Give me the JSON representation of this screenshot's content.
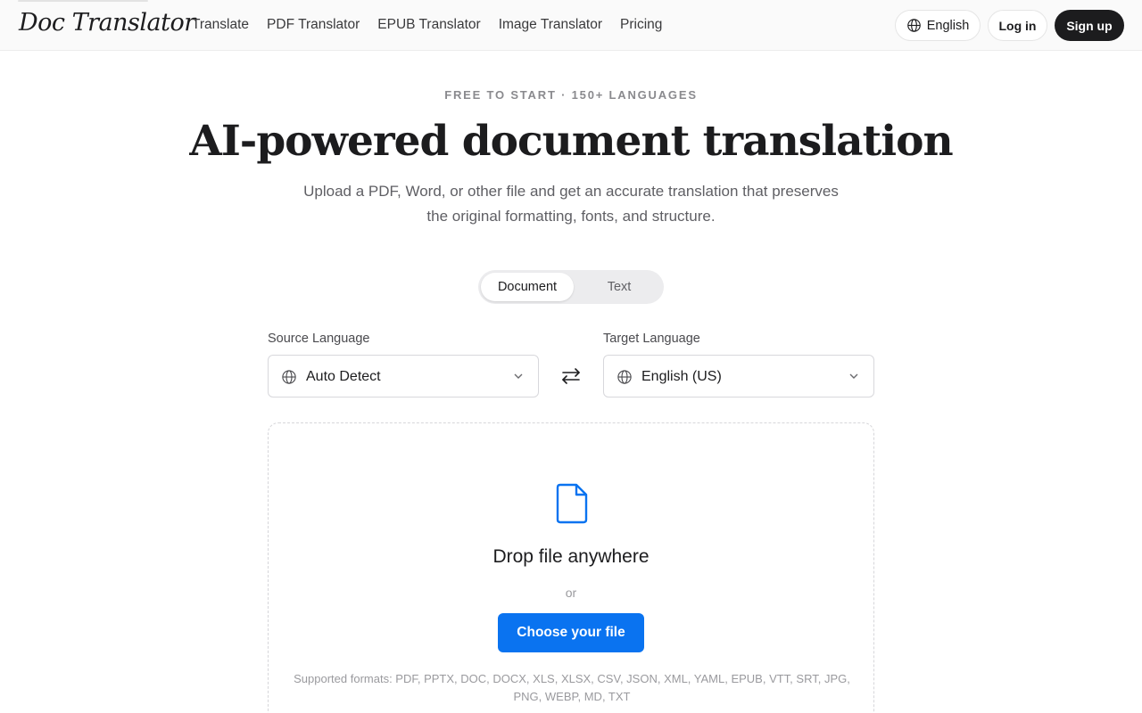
{
  "header": {
    "logo": "Doc Translator",
    "nav": [
      {
        "label": "Translate"
      },
      {
        "label": "PDF Translator"
      },
      {
        "label": "EPUB Translator"
      },
      {
        "label": "Image Translator"
      },
      {
        "label": "Pricing"
      }
    ],
    "language_button": "English",
    "login": "Log in",
    "signup": "Sign up"
  },
  "hero": {
    "eyebrow": "FREE TO START · 150+ LANGUAGES",
    "title": "AI-powered document translation",
    "subtitle": "Upload a PDF, Word, or other file and get an accurate translation that preserves the original formatting, fonts, and structure."
  },
  "mode_toggle": {
    "options": [
      {
        "label": "Document",
        "selected": true
      },
      {
        "label": "Text",
        "selected": false
      }
    ]
  },
  "languages": {
    "source_label": "Source Language",
    "source_value": "Auto Detect",
    "target_label": "Target Language",
    "target_value": "English (US)"
  },
  "dropzone": {
    "title": "Drop file anywhere",
    "or": "or",
    "button": "Choose your file",
    "formats": "Supported formats: PDF, PPTX, DOC, DOCX, XLS, XLSX, CSV, JSON, XML, YAML, EPUB, VTT, SRT, JPG, PNG, WEBP, MD, TXT"
  },
  "colors": {
    "primary": "#0a73f0",
    "dark": "#1c1c1e",
    "muted": "#8a8a8e"
  },
  "icons": {
    "language_button": "globe-icon",
    "source_select": "globe-icon",
    "target_select": "globe-icon",
    "swap": "swap-arrows-icon",
    "dropzone": "file-icon",
    "select_chevron": "chevron-down-icon"
  }
}
